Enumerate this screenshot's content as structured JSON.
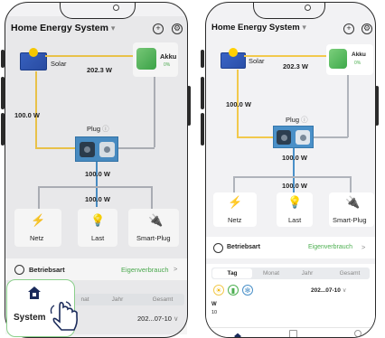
{
  "app": {
    "title": "Home Energy System",
    "title_caret": "▾"
  },
  "header_icons": [
    "plus-circle-icon",
    "settings-gear-icon"
  ],
  "flow": {
    "solar_label": "Solar",
    "solar_to_battery": "202.3 W",
    "battery_label": "Akku",
    "battery_percent": "0%",
    "solar_to_plug": "100.0 W",
    "plug_label": "Plug",
    "plug_info_icon": "ⓘ",
    "plug_out_top": "100.0 W",
    "plug_out_bottom": "100.0 W",
    "netz_label": "Netz",
    "last_label": "Last",
    "smart_plug_label": "Smart-Plug"
  },
  "mode": {
    "label": "Betriebsart",
    "value": "Eigenverbrauch",
    "chevron": ">"
  },
  "stats_tabs": [
    "Tag",
    "Monat",
    "Jahr",
    "Gesamt"
  ],
  "stats_active_tab": "Tag",
  "stats_date": "202...07-10",
  "stats_date_caret": "∨",
  "chart_axis": {
    "unit": "W",
    "top_tick": "10"
  },
  "overlay": {
    "label": "System"
  },
  "left_partial": {
    "tab_monat_partial": "nat",
    "tab_jahr": "Jahr",
    "tab_gesamt": "Gesamt",
    "date": "202...07-10"
  },
  "colors": {
    "flow_yellow": "#f2c94c",
    "flow_blue": "#4a90c8",
    "accent_green": "#4caf50",
    "overlay_border": "#8bcf8b"
  }
}
